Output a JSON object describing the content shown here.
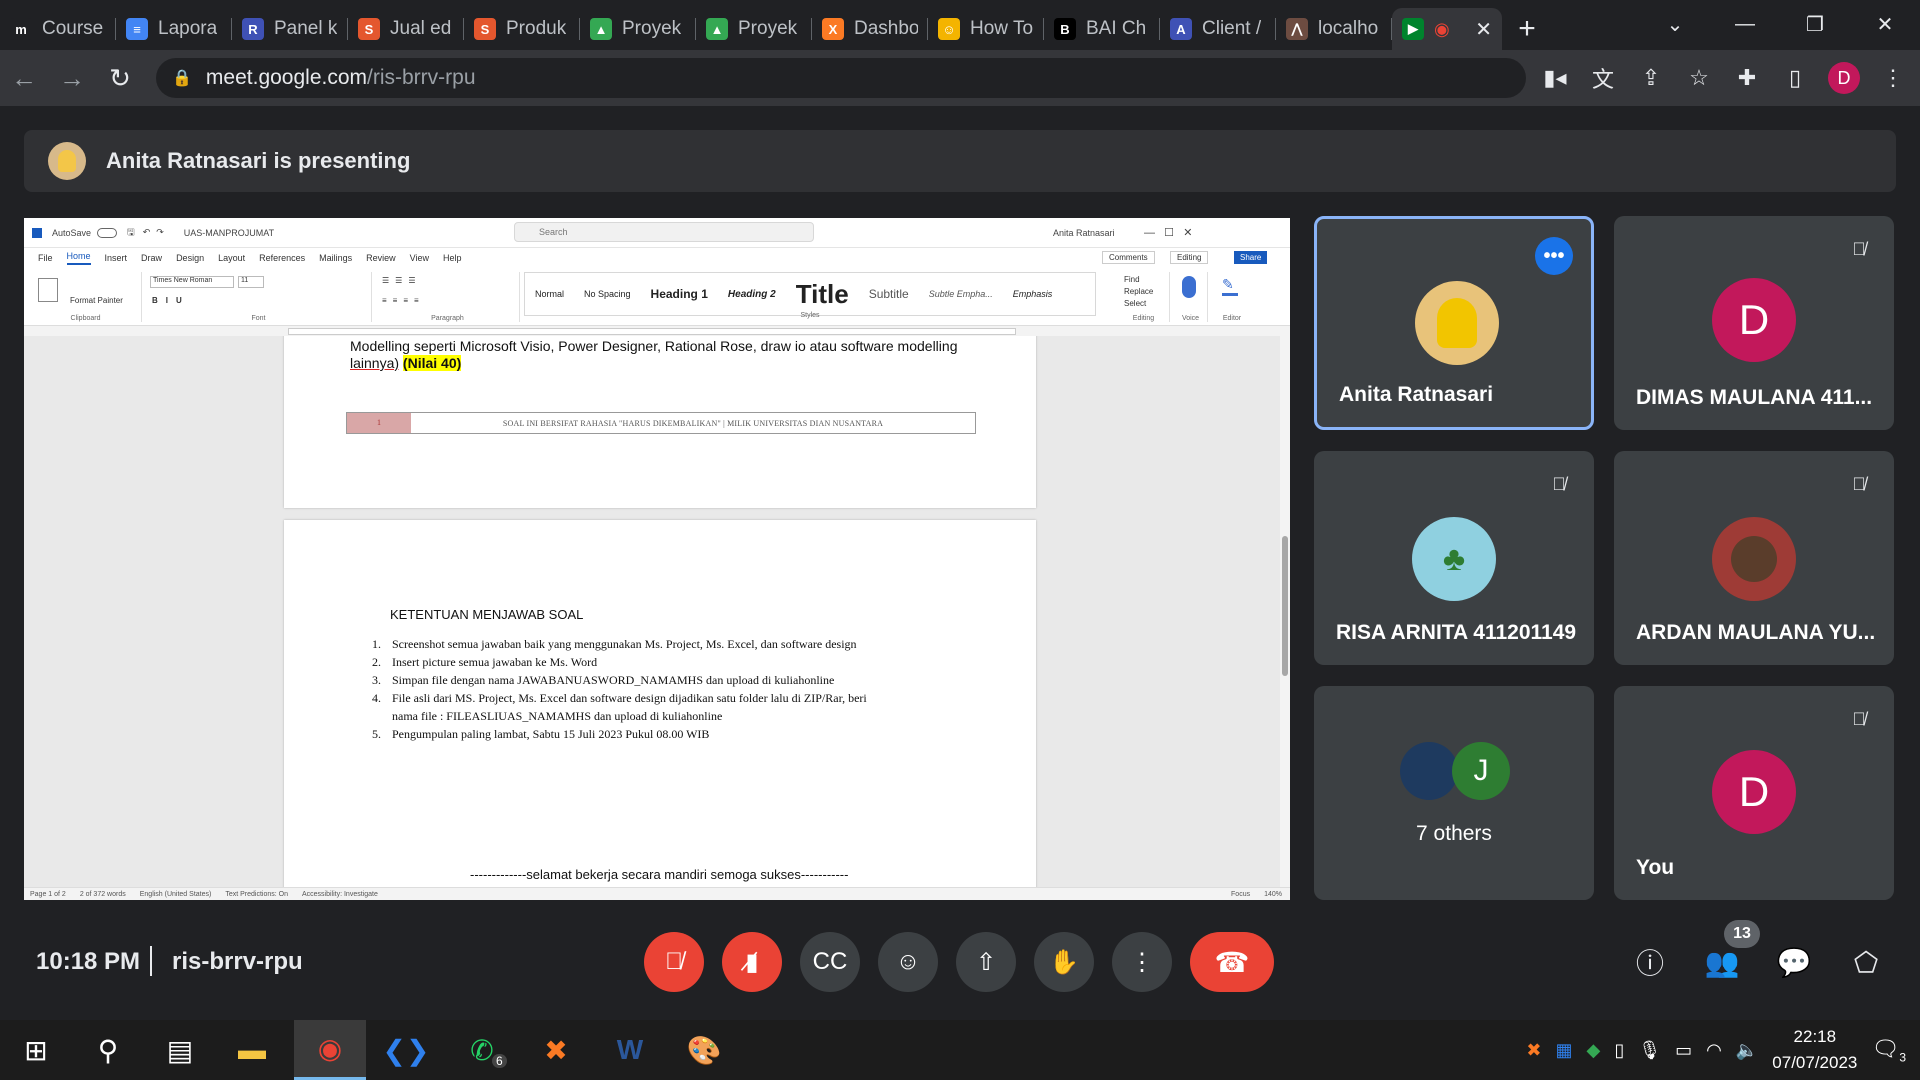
{
  "browser": {
    "tabs": [
      {
        "label": "Course",
        "favicon": "moodle-icon",
        "color": "#202124",
        "glyph": "m"
      },
      {
        "label": "Lapora",
        "favicon": "docs-icon",
        "color": "#4285f4",
        "glyph": "≡"
      },
      {
        "label": "Panel k",
        "favicon": "rc-icon",
        "color": "#3f51b5",
        "glyph": "R"
      },
      {
        "label": "Jual ed",
        "favicon": "shop-icon",
        "color": "#e4572e",
        "glyph": "S"
      },
      {
        "label": "Produk",
        "favicon": "shop-icon",
        "color": "#e4572e",
        "glyph": "S"
      },
      {
        "label": "Proyek",
        "favicon": "drive-icon",
        "color": "#34a853",
        "glyph": "▲"
      },
      {
        "label": "Proyek",
        "favicon": "drive-icon",
        "color": "#34a853",
        "glyph": "▲"
      },
      {
        "label": "Dashbo",
        "favicon": "xampp-icon",
        "color": "#fb7a24",
        "glyph": "X"
      },
      {
        "label": "How To",
        "favicon": "emoji-icon",
        "color": "#f4b400",
        "glyph": "☺"
      },
      {
        "label": "BAI Ch",
        "favicon": "bai-icon",
        "color": "#000000",
        "glyph": "B"
      },
      {
        "label": "Client /",
        "favicon": "client-icon",
        "color": "#3f51b5",
        "glyph": "A"
      },
      {
        "label": "localho",
        "favicon": "localhost-icon",
        "color": "#6d4c41",
        "glyph": "⋀"
      }
    ],
    "url_host": "meet.google.com",
    "url_path": "/ris-brrv-rpu",
    "profile_initial": "D"
  },
  "meet": {
    "presenting_text": "Anita Ratnasari is presenting",
    "participants": [
      {
        "name": "Anita Ratnasari",
        "avatar": "photo",
        "color": "#e8c37a"
      },
      {
        "name": "DIMAS MAULANA 411...",
        "initial": "D",
        "color": "#c2185b"
      },
      {
        "name": "RISA ARNITA 411201149",
        "avatar": "photo",
        "color": "#8fd0e0"
      },
      {
        "name": "ARDAN MAULANA YU...",
        "avatar": "photo",
        "color": "#9e3b36"
      },
      {
        "name": "7 others",
        "initial": "J",
        "color": "#2e7d32"
      },
      {
        "name": "You",
        "initial": "D",
        "color": "#c2185b"
      }
    ],
    "time": "10:18 PM",
    "meeting_code": "ris-brrv-rpu",
    "people_count": "13"
  },
  "word": {
    "doc_title": "UAS-MANPROJUMAT",
    "search_placeholder": "Search",
    "user": "Anita Ratnasari",
    "menu": [
      "File",
      "Home",
      "Insert",
      "Draw",
      "Design",
      "Layout",
      "References",
      "Mailings",
      "Review",
      "View",
      "Help"
    ],
    "comments": "Comments",
    "editing": "Editing",
    "share": "Share",
    "font_name": "Times New Roman",
    "font_size": "11",
    "styles": [
      "Normal",
      "No Spacing",
      "Heading 1",
      "Heading 2",
      "Title",
      "Subtitle",
      "Subtle Empha...",
      "Emphasis"
    ],
    "groups": [
      "Clipboard",
      "Font",
      "Paragraph",
      "Styles",
      "Editing",
      "Voice",
      "Editor"
    ],
    "page1_line1": "Modelling seperti Microsoft Visio, Power Designer, Rational Rose, draw io atau software modelling",
    "page1_line2": "lainnya)",
    "page1_score": "(Nilai 40)",
    "footer_num": "1",
    "footer_text": "SOAL INI BERSIFAT RAHASIA \"HARUS DIKEMBALIKAN\"  |     MILIK UNIVERSITAS DIAN NUSANTARA",
    "heading": "KETENTUAN MENJAWAB SOAL",
    "items": [
      "Screenshot semua jawaban baik yang menggunakan Ms. Project, Ms. Excel, dan software design",
      "Insert picture semua jawaban ke Ms. Word",
      "Simpan file dengan nama JAWABANUASWORD_NAMAMHS dan upload di kuliahonline",
      "File asli dari MS. Project, Ms. Excel dan software design dijadikan satu folder lalu di ZIP/Rar, beri",
      "Pengumpulan paling lambat, Sabtu 15 Juli 2023 Pukul 08.00 WIB"
    ],
    "item4_cont": "nama file : FILEASLIUAS_NAMAMHS dan upload di kuliahonline",
    "closing": "-------------selamat bekerja secara mandiri semoga sukses-----------",
    "status_page": "Page 1 of 2",
    "status_words": "2 of 372 words",
    "status_lang": "English (United States)",
    "status_pred": "Text Predictions: On",
    "status_acc": "Accessibility: Investigate",
    "status_focus": "Focus",
    "zoom": "140%"
  },
  "taskbar": {
    "time": "22:18",
    "date": "07/07/2023",
    "whatsapp_badge": "6",
    "notif_badge": "3"
  }
}
